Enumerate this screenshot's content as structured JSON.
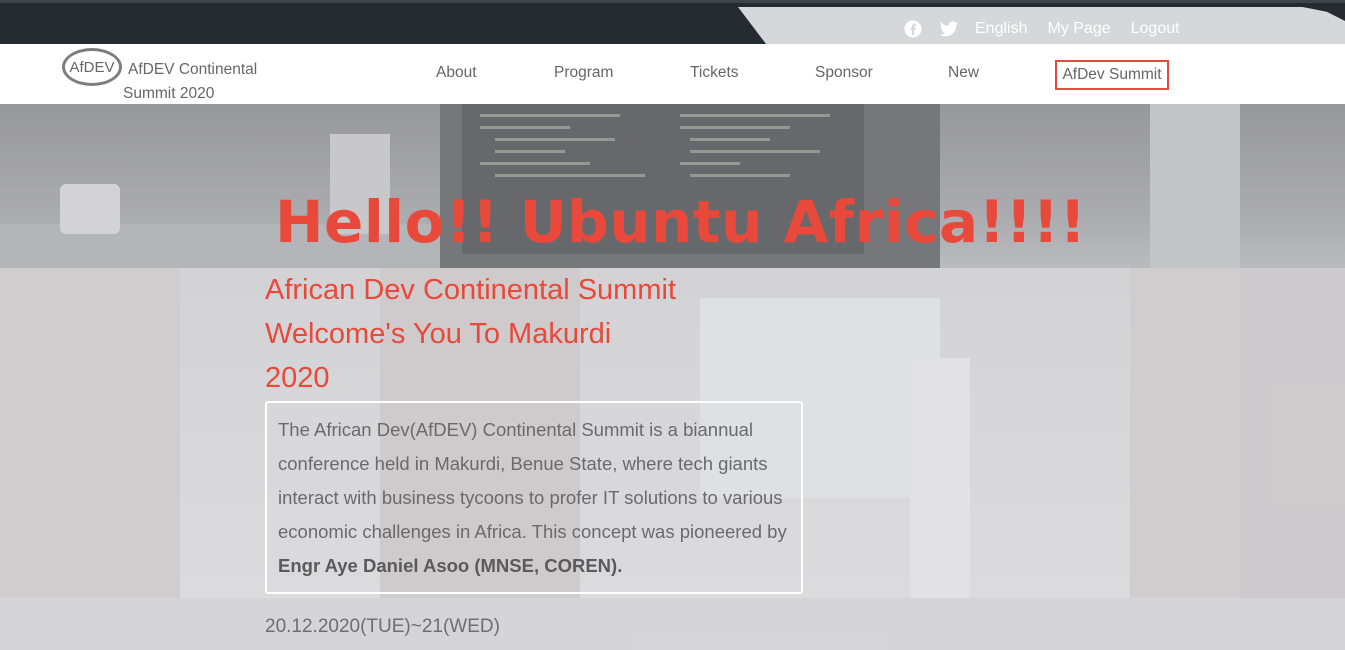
{
  "utility": {
    "facebook_icon": "facebook-icon",
    "twitter_icon": "twitter-icon",
    "language": "English",
    "my_page": "My Page",
    "logout": "Logout"
  },
  "brand": {
    "logo_text": "AfDEV",
    "name": "AfDEV Continental Summit 2020"
  },
  "nav": {
    "items": [
      "About",
      "Program",
      "Tickets",
      "Sponsor",
      "New"
    ],
    "cta": "AfDev Summit"
  },
  "hero": {
    "title": "Hello!! Ubuntu Africa!!!!",
    "subtitle_line1": "African Dev Continental Summit",
    "subtitle_line2": "Welcome's You To Makurdi",
    "subtitle_line3": "2020",
    "description": "The African Dev(AfDEV) Continental Summit is a biannual conference held in Makurdi, Benue State, where tech giants interact with business tycoons to profer IT solutions to various economic challenges in Africa. This concept was pioneered by",
    "pioneer": "Engr Aye Daniel Asoo (MNSE, COREN).",
    "date": "20.12.2020(TUE)~21(WED)"
  },
  "colors": {
    "accent": "#e8493a",
    "topbar": "#262a31",
    "utility_shape": "#d6d7da"
  }
}
